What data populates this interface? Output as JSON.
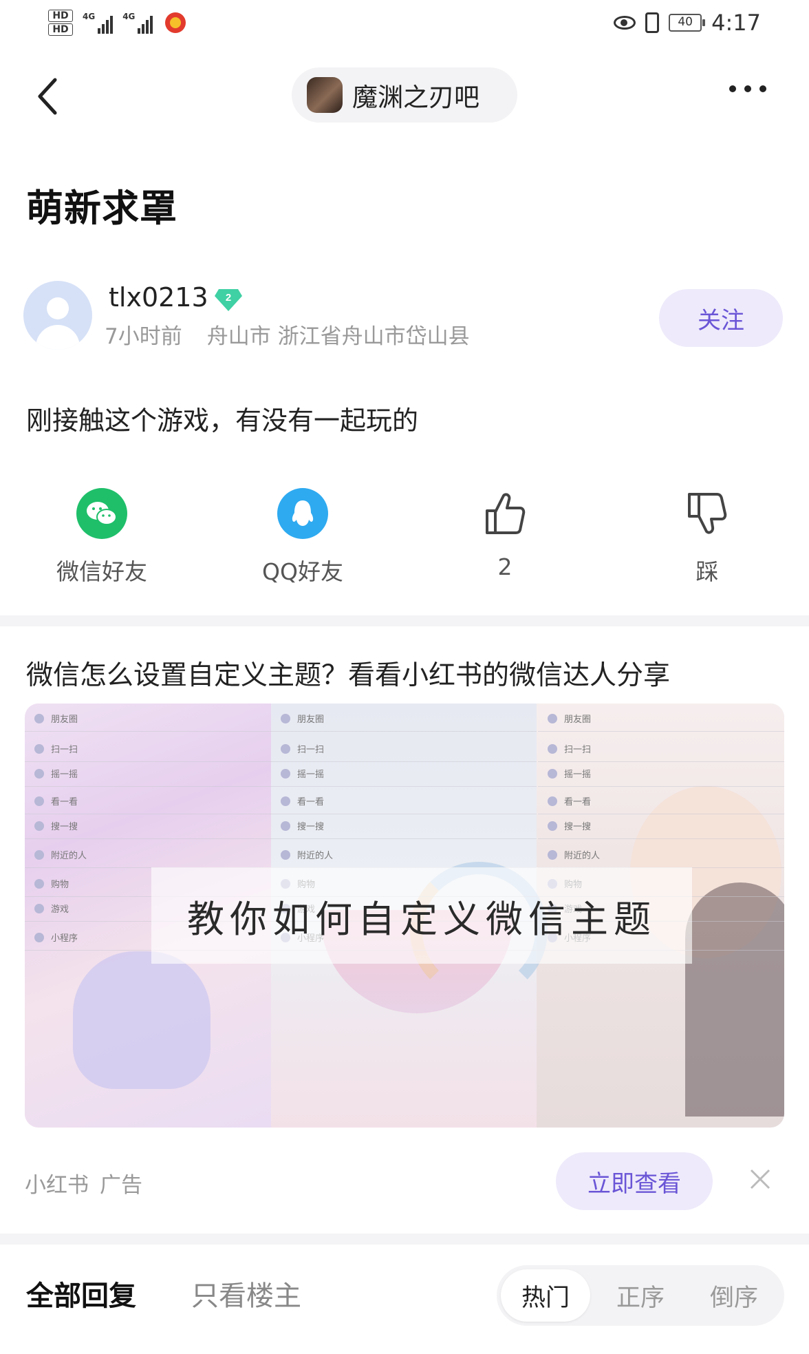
{
  "status_bar": {
    "sim1_label": "HD",
    "sim2_label": "HD",
    "net1": "4G",
    "net2": "4G",
    "battery": "40",
    "time": "4:17"
  },
  "header": {
    "forum_name": "魔渊之刃吧"
  },
  "post": {
    "title": "萌新求罩",
    "author": {
      "username": "tlx0213",
      "level": "2",
      "time_ago": "7小时前",
      "location": "舟山市 浙江省舟山市岱山县",
      "follow_label": "关注"
    },
    "content": "刚接触这个游戏，有没有一起玩的",
    "actions": {
      "wechat_label": "微信好友",
      "qq_label": "QQ好友",
      "like_count": "2",
      "dislike_label": "踩"
    }
  },
  "ad": {
    "title": "微信怎么设置自定义主题？看看小红书的微信达人分享",
    "overlay_text": "教你如何自定义微信主题",
    "menu_items": [
      "朋友圈",
      "扫一扫",
      "摇一摇",
      "看一看",
      "搜一搜",
      "附近的人",
      "购物",
      "游戏",
      "小程序"
    ],
    "source": "小红书",
    "tag": "广告",
    "cta_label": "立即查看"
  },
  "replies": {
    "tab_all": "全部回复",
    "tab_op": "只看楼主",
    "sort_options": [
      "热门",
      "正序",
      "倒序"
    ],
    "active_sort": "热门"
  },
  "colors": {
    "accent": "#6a55d6",
    "accent_bg": "#eeeafb",
    "wechat_green": "#1fbf6a",
    "qq_blue": "#2eaaf0"
  }
}
